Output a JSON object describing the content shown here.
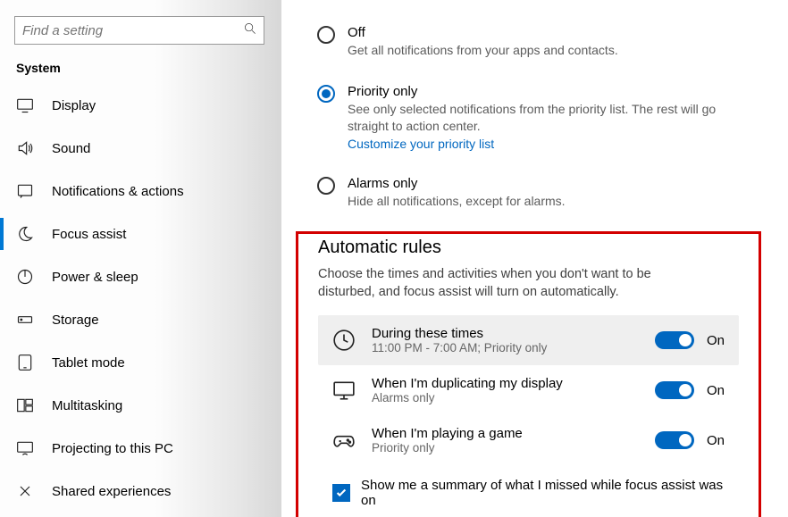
{
  "search": {
    "placeholder": "Find a setting"
  },
  "section": "System",
  "nav": [
    {
      "id": "display",
      "label": "Display"
    },
    {
      "id": "sound",
      "label": "Sound"
    },
    {
      "id": "notifications",
      "label": "Notifications & actions"
    },
    {
      "id": "focus",
      "label": "Focus assist",
      "selected": true
    },
    {
      "id": "power",
      "label": "Power & sleep"
    },
    {
      "id": "storage",
      "label": "Storage"
    },
    {
      "id": "tablet",
      "label": "Tablet mode"
    },
    {
      "id": "multitasking",
      "label": "Multitasking"
    },
    {
      "id": "projecting",
      "label": "Projecting to this PC"
    },
    {
      "id": "shared",
      "label": "Shared experiences"
    }
  ],
  "radios": {
    "off": {
      "title": "Off",
      "sub": "Get all notifications from your apps and contacts."
    },
    "priority": {
      "title": "Priority only",
      "sub": "See only selected notifications from the priority list. The rest will go straight to action center.",
      "link": "Customize your priority list"
    },
    "alarms": {
      "title": "Alarms only",
      "sub": "Hide all notifications, except for alarms."
    }
  },
  "auto": {
    "heading": "Automatic rules",
    "desc": "Choose the times and activities when you don't want to be disturbed, and focus assist will turn on automatically.",
    "rules": [
      {
        "title": "During these times",
        "sub": "11:00 PM - 7:00 AM; Priority only",
        "state": "On"
      },
      {
        "title": "When I'm duplicating my display",
        "sub": "Alarms only",
        "state": "On"
      },
      {
        "title": "When I'm playing a game",
        "sub": "Priority only",
        "state": "On"
      }
    ],
    "summary_checkbox": "Show me a summary of what I missed while focus assist was on"
  }
}
